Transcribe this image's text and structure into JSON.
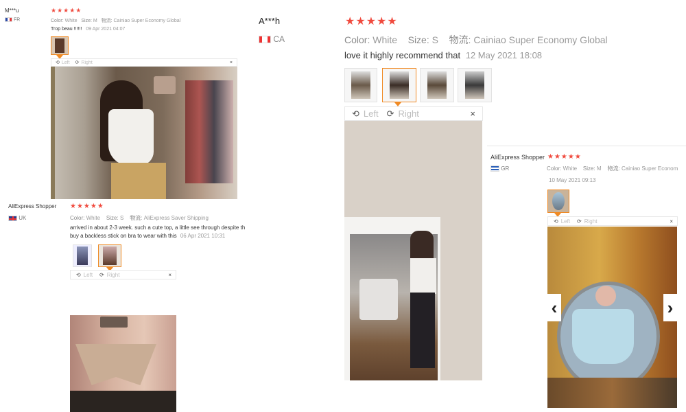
{
  "left_review_1": {
    "reviewer": "M***u",
    "country": "FR",
    "stars": "★★★★★",
    "color_label": "Color:",
    "color_value": "White",
    "size_label": "Size:",
    "size_value": "M",
    "shipping_label": "物流:",
    "shipping_value": "Cainiao Super Economy Global",
    "comment": "Trop beau !!!!!!",
    "date": "09 Apr 2021 04:07",
    "toolbar": {
      "left": "Left",
      "right": "Right",
      "close": "×"
    }
  },
  "next_reviewer": {
    "name": "A***h",
    "country": "CA"
  },
  "left_review_2": {
    "reviewer": "AliExpress Shopper",
    "country": "UK",
    "stars": "★★★★★",
    "color_label": "Color:",
    "color_value": "White",
    "size_label": "Size:",
    "size_value": "S",
    "shipping_label": "物流:",
    "shipping_value": "AliExpress Saver Shipping",
    "comment_line1": "arrived in about 2-3 week. such a cute top, a little see through despite th",
    "comment_line2": "buy a backless stick on bra to wear with this",
    "date": "06 Apr 2021 10:31",
    "toolbar": {
      "left": "Left",
      "right": "Right",
      "close": "×"
    }
  },
  "middle_review": {
    "stars": "★★★★★",
    "color_label": "Color:",
    "color_value": "White",
    "size_label": "Size:",
    "size_value": "S",
    "shipping_label": "物流:",
    "shipping_value": "Cainiao Super Economy Global",
    "comment": "love it highly recommend that",
    "date": "12 May 2021 18:08",
    "toolbar": {
      "left": "Left",
      "right": "Right",
      "close": "×"
    }
  },
  "right_review": {
    "reviewer": "AliExpress Shopper",
    "country": "GR",
    "stars": "★★★★★",
    "color_label": "Color:",
    "color_value": "White",
    "size_label": "Size:",
    "size_value": "M",
    "shipping_label": "物流:",
    "shipping_value": "Cainiao Super Econom",
    "date": "10 May 2021 09:13",
    "toolbar": {
      "left": "Left",
      "right": "Right",
      "close": "×"
    },
    "prev_arrow": "‹",
    "next_arrow": "›"
  },
  "icons": {
    "rotate_left": "⟲",
    "rotate_right": "⟳"
  },
  "colors": {
    "star": "#f04a3e",
    "active_thumb": "#f08a24"
  }
}
